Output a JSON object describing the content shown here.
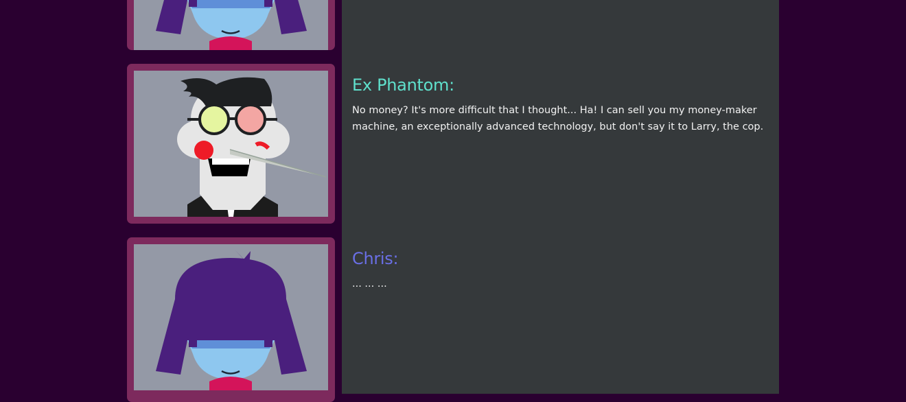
{
  "conversation": {
    "entries": [
      {
        "speaker": "",
        "text": "",
        "portrait_icon": "chris-portrait-icon"
      },
      {
        "speaker": "Ex Phantom:",
        "speaker_color": "#5fe0cc",
        "text": "No money? It's more difficult that I thought... Ha! I can sell you my money-maker machine, an exceptionally advanced technology, but don't say it to Larry, the cop.",
        "portrait_icon": "ex-phantom-portrait-icon"
      },
      {
        "speaker": "Chris:",
        "speaker_color": "#6a6fe6",
        "text": "... ... ...",
        "portrait_icon": "chris-portrait-icon"
      }
    ]
  },
  "colors": {
    "page_background": "#2a0030",
    "dialog_panel": "#35393b",
    "portrait_frame": "#7d2a5d",
    "portrait_background": "#9499a6"
  }
}
